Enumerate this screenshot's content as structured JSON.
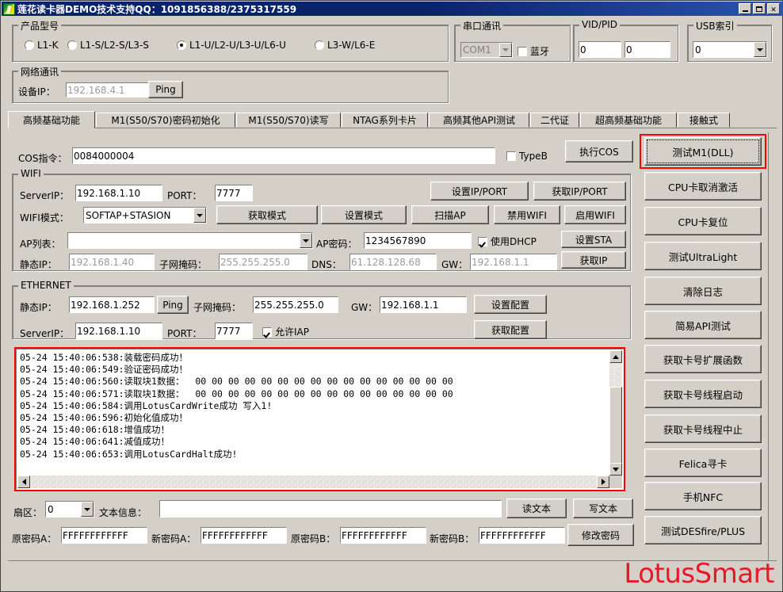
{
  "window": {
    "title": "莲花读卡器DEMO技术支持QQ：1091856388/2375317559",
    "minimize": "_",
    "maximize": "□",
    "close": "✕"
  },
  "product_group": {
    "legend": "产品型号",
    "options": [
      {
        "label": "L1-K",
        "selected": false
      },
      {
        "label": "L1-S/L2-S/L3-S",
        "selected": false
      },
      {
        "label": "L1-U/L2-U/L3-U/L6-U",
        "selected": true
      },
      {
        "label": "L3-W/L6-E",
        "selected": false
      }
    ]
  },
  "network_group": {
    "legend": "网络通讯",
    "device_ip_label": "设备IP：",
    "device_ip_value": "192.168.4.1",
    "ping_label": "Ping"
  },
  "serial_group": {
    "legend": "串口通讯",
    "port_value": "COM1",
    "bluetooth_label": "蓝牙",
    "bluetooth_checked": false
  },
  "vidpid_group": {
    "legend": "VID/PID",
    "vid_value": "0",
    "pid_value": "0"
  },
  "usb_group": {
    "legend": "USB索引",
    "index_value": "0"
  },
  "tabs": [
    {
      "label": "高频基础功能",
      "selected": true
    },
    {
      "label": "M1(S50/S70)密码初始化",
      "selected": false
    },
    {
      "label": "M1(S50/S70)读写",
      "selected": false
    },
    {
      "label": "NTAG系列卡片",
      "selected": false
    },
    {
      "label": "高频其他API测试",
      "selected": false
    },
    {
      "label": "二代证",
      "selected": false
    },
    {
      "label": "超高频基础功能",
      "selected": false
    },
    {
      "label": "接触式",
      "selected": false
    }
  ],
  "cos_row": {
    "label": "COS指令：",
    "value": "0084000004",
    "typeb_label": "TypeB",
    "typeb_checked": false,
    "exec_label": "执行COS"
  },
  "wifi_group": {
    "legend": "WIFI",
    "server_ip_label": "ServerIP：",
    "server_ip_value": "192.168.1.10",
    "port_label": "PORT：",
    "port_value": "7777",
    "set_ip_port_label": "设置IP/PORT",
    "get_ip_port_label": "获取IP/PORT",
    "mode_label": "WIFI模式：",
    "mode_value": "SOFTAP+STASION",
    "get_mode_label": "获取模式",
    "set_mode_label": "设置模式",
    "scan_ap_label": "扫描AP",
    "disable_wifi_label": "禁用WIFI",
    "enable_wifi_label": "启用WIFI",
    "ap_list_label": "AP列表：",
    "ap_list_value": "",
    "ap_pwd_label": "AP密码：",
    "ap_pwd_value": "1234567890",
    "dhcp_label": "使用DHCP",
    "dhcp_checked": true,
    "set_sta_label": "设置STA",
    "static_ip_label": "静态IP：",
    "static_ip_value": "192.168.1.40",
    "mask_label": "子网掩码：",
    "mask_value": "255.255.255.0",
    "dns_label": "DNS：",
    "dns_value": "61.128.128.68",
    "gw_label": "GW：",
    "gw_value": "192.168.1.1",
    "get_ip_label": "获取IP"
  },
  "ethernet_group": {
    "legend": "ETHERNET",
    "static_ip_label": "静态IP：",
    "static_ip_value": "192.168.1.252",
    "ping_label": "Ping",
    "mask_label": "子网掩码：",
    "mask_value": "255.255.255.0",
    "gw_label": "GW：",
    "gw_value": "192.168.1.1",
    "set_config_label": "设置配置",
    "server_ip_label": "ServerIP：",
    "server_ip_value": "192.168.1.10",
    "port_label": "PORT：",
    "port_value": "7777",
    "iap_label": "允许IAP",
    "iap_checked": true,
    "get_config_label": "获取配置"
  },
  "log": {
    "lines": [
      "05-24 15:40:06:538:装载密码成功！",
      "05-24 15:40:06:549:验证密码成功！",
      "05-24 15:40:06:560:读取块1数据：  00 00 00 00 00 00 00 00 00 00 00 00 00 00 00 00",
      "05-24 15:40:06:571:读取块1数据：  00 00 00 00 00 00 00 00 00 00 00 00 00 00 00 00",
      "05-24 15:40:06:584:调用LotusCardWrite成功 写入1!",
      "05-24 15:40:06:596:初始化值成功！",
      "05-24 15:40:06:618:增值成功！",
      "05-24 15:40:06:641:减值成功！",
      "05-24 15:40:06:653:调用LotusCardHalt成功!"
    ]
  },
  "bottom": {
    "sector_label": "扇区：",
    "sector_value": "0",
    "text_info_label": "文本信息：",
    "text_info_value": "",
    "read_text_label": "读文本",
    "write_text_label": "写文本",
    "old_pwd_a_label": "原密码A：",
    "old_pwd_a_value": "FFFFFFFFFFFF",
    "new_pwd_a_label": "新密码A：",
    "new_pwd_a_value": "FFFFFFFFFFFF",
    "old_pwd_b_label": "原密码B：",
    "old_pwd_b_value": "FFFFFFFFFFFF",
    "new_pwd_b_label": "新密码B：",
    "new_pwd_b_value": "FFFFFFFFFFFF",
    "change_pwd_label": "修改密码"
  },
  "right_buttons": [
    {
      "label": "测试M1(DLL)",
      "focused": true
    },
    {
      "label": "CPU卡取消激活",
      "focused": false
    },
    {
      "label": "CPU卡复位",
      "focused": false
    },
    {
      "label": "测试UltraLight",
      "focused": false
    },
    {
      "label": "清除日志",
      "focused": false
    },
    {
      "label": "简易API测试",
      "focused": false
    },
    {
      "label": "获取卡号扩展函数",
      "focused": false
    },
    {
      "label": "获取卡号线程启动",
      "focused": false
    },
    {
      "label": "获取卡号线程中止",
      "focused": false
    },
    {
      "label": "Felica寻卡",
      "focused": false
    },
    {
      "label": "手机NFC",
      "focused": false
    },
    {
      "label": "测试DESfire/PLUS",
      "focused": false
    }
  ],
  "brand": {
    "logo_text": "LotusSmart",
    "logo_color": "#e8182a"
  }
}
